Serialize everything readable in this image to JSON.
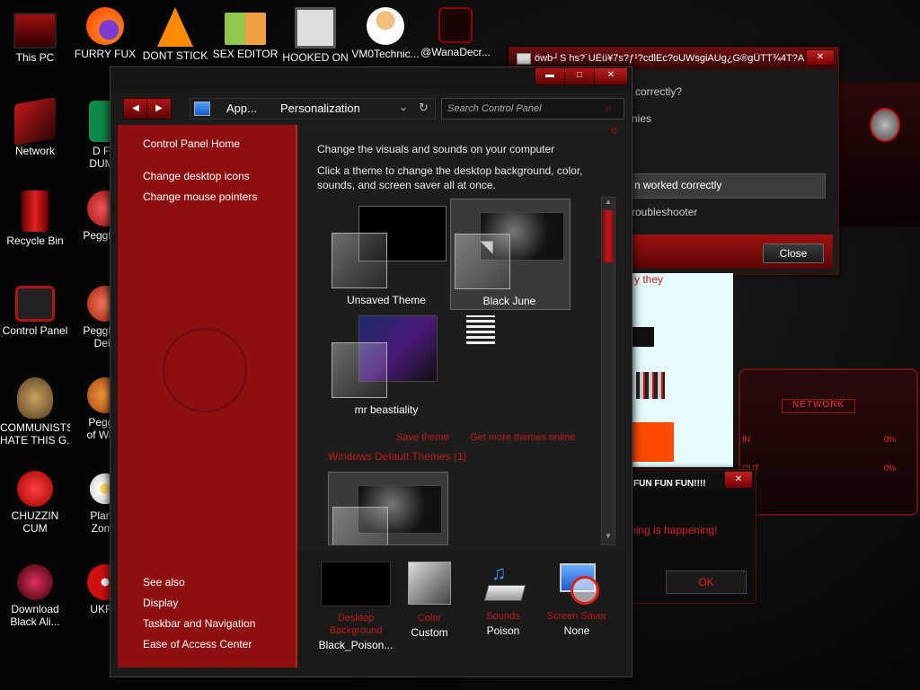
{
  "desktop": {
    "icons": [
      {
        "label": "This PC"
      },
      {
        "label": "FURRY FUX"
      },
      {
        "label": "DONT STICK"
      },
      {
        "label": "SEX EDITOR"
      },
      {
        "label": "HOOKED ON"
      },
      {
        "label": "VM0Technic..."
      },
      {
        "label": "@WanaDecr..."
      },
      {
        "label": "Network"
      },
      {
        "label": "D FC",
        "label2": "DUMB"
      },
      {
        "label": "Recycle Bin"
      },
      {
        "label": "Peggle D"
      },
      {
        "label": "Control Panel"
      },
      {
        "label": "Peggle N",
        "label2": "Delu"
      },
      {
        "label": "COMMUNISTS",
        "label2": "HATE THIS G..."
      },
      {
        "label": "Peggle",
        "label2": "of Warc"
      },
      {
        "label": "CHUZZIN",
        "label2": "CUM"
      },
      {
        "label": "Plants",
        "label2": "Zomb"
      },
      {
        "label": "Download",
        "label2": "Black Ali..."
      },
      {
        "label": "UKRA"
      }
    ]
  },
  "troubleshoot_window": {
    "title": "öwb┘S hs?˙UÉü¥7s?ƒ¹?cdlEc?oUWsgiAUg¿G®gÜTT¾4T?A...",
    "q_text": "correctly?",
    "partial_text": "nies",
    "row_text": "n worked correctly",
    "link_text": "roubleshooter",
    "close_label": "Close"
  },
  "popup_window": {
    "title": "FUN FUN FUN!!!!",
    "message": "hing is happening!",
    "ok_label": "OK",
    "they_text": "y they"
  },
  "network_widget": {
    "label": "NETWORK",
    "in_label": "IN",
    "out_label": "OUT",
    "in_value": "0%",
    "out_value": "0%"
  },
  "main_window": {
    "breadcrumb_root": "App...",
    "breadcrumb_current": "Personalization",
    "search_placeholder": "Search Control Panel",
    "sidebar": {
      "home": "Control Panel Home",
      "links": [
        "Change desktop icons",
        "Change mouse pointers"
      ],
      "see_also_header": "See also",
      "see_also": [
        "Display",
        "Taskbar and Navigation",
        "Ease of Access Center"
      ]
    },
    "heading": "Change the visuals and sounds on your computer",
    "description_line1": "Click a theme to change the desktop background, color,",
    "description_line2": "sounds, and screen saver all at once.",
    "themes": [
      {
        "name": "Unsaved Theme"
      },
      {
        "name": "Black June"
      },
      {
        "name": "mr beastiality"
      }
    ],
    "save_theme": "Save theme",
    "get_more_themes": "Get more themes online",
    "default_section": "Windows Default Themes (1)",
    "bottom": {
      "desktop_background": {
        "label1": "Desktop",
        "label2": "Background",
        "value": "Black_Poison..."
      },
      "color": {
        "label": "Color",
        "value": "Custom"
      },
      "sounds": {
        "label": "Sounds",
        "value": "Poison"
      },
      "screen_saver": {
        "label": "Screen Saver",
        "value": "None"
      }
    }
  },
  "colors": {
    "accent_red": "#8e0f0f",
    "link_red": "#c41a1a",
    "window_bg": "#1b1b1b"
  }
}
